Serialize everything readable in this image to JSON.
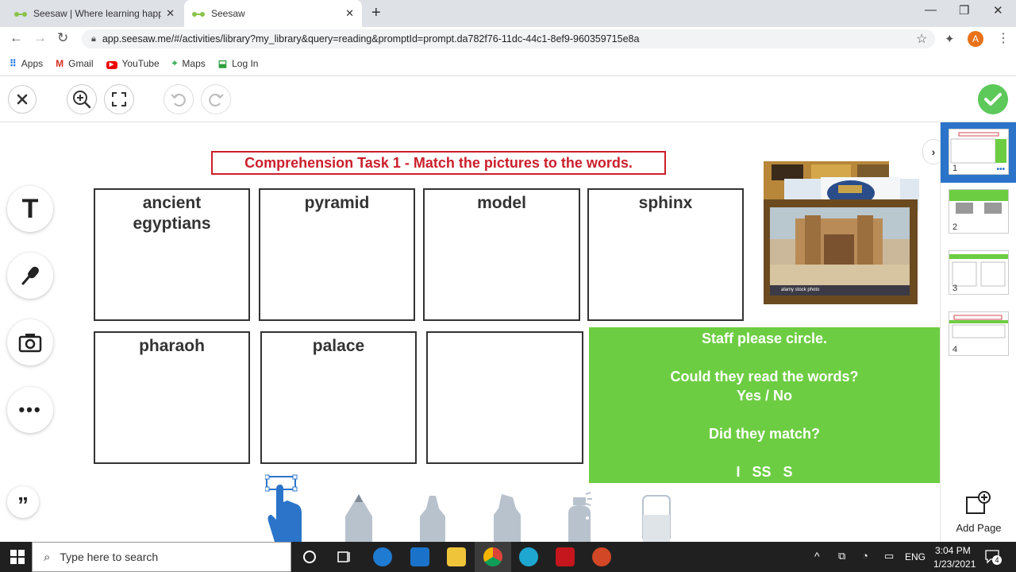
{
  "browser": {
    "tabs": [
      {
        "title": "Seesaw | Where learning happen",
        "close": "✕"
      },
      {
        "title": "Seesaw",
        "close": "✕"
      }
    ],
    "new_tab": "+",
    "window_controls": {
      "minimize": "—",
      "maximize": "❐",
      "close": "✕"
    },
    "url": "app.seesaw.me/#/activities/library?my_library&query=reading&promptId=prompt.da782f76-11dc-44c1-8ef9-960359715e8a",
    "profile_initial": "A",
    "bookmarks": [
      {
        "label": "Apps",
        "icon": "apps-grid-icon"
      },
      {
        "label": "Gmail",
        "icon": "gmail-icon"
      },
      {
        "label": "YouTube",
        "icon": "youtube-icon"
      },
      {
        "label": "Maps",
        "icon": "maps-icon"
      },
      {
        "label": "Log In",
        "icon": "login-icon"
      }
    ]
  },
  "canvas": {
    "title": "Comprehension Task 1 - Match the pictures to the words.",
    "cells_row1": [
      "ancient\negyptians",
      "pyramid",
      "model",
      "sphinx"
    ],
    "cells_row2": [
      "pharaoh",
      "palace",
      ""
    ],
    "image_caption": "alamy stock photo",
    "staff_box": {
      "line1": "Staff please circle.",
      "line2": "Could they read the words?",
      "line3": "Yes / No",
      "line4": "Did they match?",
      "line5": "I   SS   S"
    }
  },
  "pages": {
    "numbers": [
      "1",
      "2",
      "3",
      "4"
    ],
    "more": "•••",
    "add_page_label": "Add Page"
  },
  "taskbar": {
    "search_placeholder": "Type here to search",
    "lang": "ENG",
    "time": "3:04 PM",
    "date": "1/23/2021",
    "notifications": "4"
  },
  "colors": {
    "title_red": "#cc1e2b",
    "staff_green": "#6dcd42",
    "done_green": "#5cc95a",
    "tool_blue": "#2b74c9",
    "tool_gray": "#b8c2cc"
  }
}
